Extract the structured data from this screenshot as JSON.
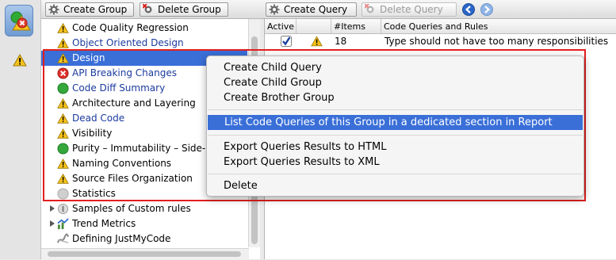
{
  "toolbar_left": {
    "create_group": "Create Group",
    "delete_group": "Delete Group"
  },
  "toolbar_right": {
    "create_query": "Create Query",
    "delete_query": "Delete Query",
    "back_icon": "back-arrow-icon",
    "forward_icon": "forward-arrow-icon"
  },
  "tree": {
    "items": [
      {
        "label": "Code Quality Regression",
        "icon": "warning-icon"
      },
      {
        "label": "Object Oriented Design",
        "icon": "warning-icon"
      },
      {
        "label": "Design",
        "icon": "warning-icon"
      },
      {
        "label": "API Breaking Changes",
        "icon": "error-icon"
      },
      {
        "label": "Code Diff Summary",
        "icon": "ok-icon"
      },
      {
        "label": "Architecture and Layering",
        "icon": "warning-icon"
      },
      {
        "label": "Dead Code",
        "icon": "warning-icon"
      },
      {
        "label": "Visibility",
        "icon": "warning-icon"
      },
      {
        "label": "Purity – Immutability – Side-Ef",
        "icon": "ok-icon"
      },
      {
        "label": "Naming Conventions",
        "icon": "warning-icon"
      },
      {
        "label": "Source Files Organization",
        "icon": "warning-icon"
      },
      {
        "label": "Statistics",
        "icon": "neutral-icon"
      },
      {
        "label": "Samples of Custom rules",
        "icon": "samples-icon"
      },
      {
        "label": "Trend Metrics",
        "icon": "trend-icon"
      },
      {
        "label": "Defining JustMyCode",
        "icon": "justmycode-icon"
      }
    ]
  },
  "table": {
    "headers": {
      "active": "Active",
      "items": "#Items",
      "rules": "Code Queries and Rules"
    },
    "rows": [
      {
        "active": true,
        "status": "warning-icon",
        "items": "18",
        "rule": "Type should not have too many responsibilities"
      }
    ]
  },
  "context_menu": {
    "create_child_query": "Create Child Query",
    "create_child_group": "Create Child Group",
    "create_brother_group": "Create Brother Group",
    "list_queries": "List Code Queries of this Group in a dedicated section in Report",
    "export_html": "Export Queries Results to HTML",
    "export_xml": "Export Queries Results to XML",
    "delete": "Delete"
  },
  "colors": {
    "selection": "#3a6fd8",
    "highlight_frame": "#e21f1f",
    "link_blue": "#1b3a9e"
  }
}
